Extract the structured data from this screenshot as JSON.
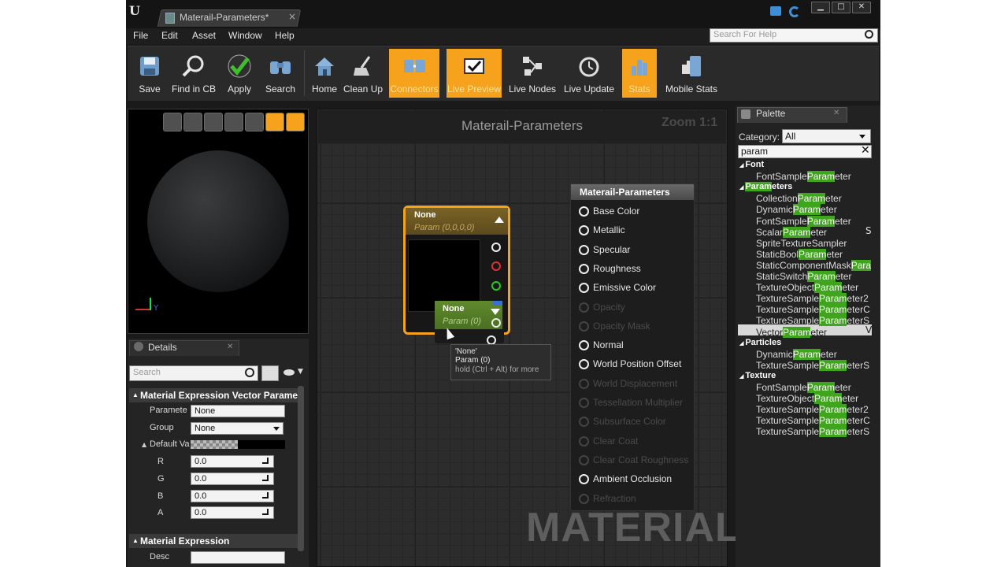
{
  "window": {
    "tab_title": "Materail-Parameters*",
    "tab_close": "×"
  },
  "menu": [
    "File",
    "Edit",
    "Asset",
    "Window",
    "Help"
  ],
  "help_search": {
    "placeholder": "Search For Help"
  },
  "toolbar": [
    {
      "label": "Save",
      "icon": "save-icon",
      "active": false
    },
    {
      "label": "Find in CB",
      "icon": "find-in-cb-icon",
      "active": false
    },
    {
      "label": "Apply",
      "icon": "apply-checkmark-icon",
      "active": false
    },
    {
      "label": "Search",
      "icon": "search-binoculars-icon",
      "active": false
    },
    {
      "label": "Home",
      "icon": "home-icon",
      "active": false
    },
    {
      "label": "Clean Up",
      "icon": "clean-up-broom-icon",
      "active": false
    },
    {
      "label": "Connectors",
      "icon": "connectors-icon",
      "active": true
    },
    {
      "label": "Live Preview",
      "icon": "live-preview-icon",
      "active": true
    },
    {
      "label": "Live Nodes",
      "icon": "live-nodes-icon",
      "active": false
    },
    {
      "label": "Live Update",
      "icon": "live-update-icon",
      "active": false
    },
    {
      "label": "Stats",
      "icon": "stats-icon",
      "active": true
    },
    {
      "label": "Mobile Stats",
      "icon": "mobile-stats-icon",
      "active": false
    }
  ],
  "details": {
    "title": "Details",
    "search_placeholder": "Search",
    "section1": "Material Expression Vector Paramet",
    "parameter_label": "Paramete",
    "parameter_value": "None",
    "group_label": "Group",
    "group_value": "None",
    "default_label": "Default Va",
    "r_label": "R",
    "r_value": "0.0",
    "g_label": "G",
    "g_value": "0.0",
    "b_label": "B",
    "b_value": "0.0",
    "a_label": "A",
    "a_value": "0.0",
    "section2": "Material Expression",
    "desc_label": "Desc",
    "desc_value": ""
  },
  "graph": {
    "title": "Materail-Parameters",
    "zoom": "Zoom 1:1",
    "watermark": "MATERIAL",
    "vector_node": {
      "title": "None",
      "subtitle": "Param (0,0,0,0)"
    },
    "scalar_node": {
      "title": "None",
      "subtitle": "Param (0)"
    },
    "tooltip": {
      "line1": "'None'",
      "line2": "Param (0)",
      "line3": "hold (Ctrl + Alt) for more"
    },
    "result_node": {
      "title": "Materail-Parameters",
      "inputs": [
        {
          "label": "Base Color",
          "enabled": true
        },
        {
          "label": "Metallic",
          "enabled": true
        },
        {
          "label": "Specular",
          "enabled": true
        },
        {
          "label": "Roughness",
          "enabled": true
        },
        {
          "label": "Emissive Color",
          "enabled": true
        },
        {
          "label": "Opacity",
          "enabled": false
        },
        {
          "label": "Opacity Mask",
          "enabled": false
        },
        {
          "label": "Normal",
          "enabled": true
        },
        {
          "label": "World Position Offset",
          "enabled": true
        },
        {
          "label": "World Displacement",
          "enabled": false
        },
        {
          "label": "Tessellation Multiplier",
          "enabled": false
        },
        {
          "label": "Subsurface Color",
          "enabled": false
        },
        {
          "label": "Clear Coat",
          "enabled": false
        },
        {
          "label": "Clear Coat Roughness",
          "enabled": false
        },
        {
          "label": "Ambient Occlusion",
          "enabled": true
        },
        {
          "label": "Refraction",
          "enabled": false
        }
      ]
    }
  },
  "palette": {
    "title": "Palette",
    "category_label": "Category:",
    "category_value": "All",
    "search_value": "param",
    "groups": [
      {
        "name_pre": "",
        "name_hl": "",
        "name_post": "Font",
        "items": [
          {
            "pre": "FontSample",
            "hl": "Param",
            "post": "eter"
          }
        ]
      },
      {
        "name_pre": "",
        "name_hl": "Param",
        "name_post": "eters",
        "items": [
          {
            "pre": "Collection",
            "hl": "Param",
            "post": "eter"
          },
          {
            "pre": "Dynamic",
            "hl": "Param",
            "post": "eter"
          },
          {
            "pre": "FontSample",
            "hl": "Param",
            "post": "eter"
          },
          {
            "pre": "Scalar",
            "hl": "Param",
            "post": "eter"
          },
          {
            "pre": "SpriteTextureSampler",
            "hl": "",
            "post": ""
          },
          {
            "pre": "StaticBool",
            "hl": "Param",
            "post": "eter"
          },
          {
            "pre": "StaticComponentMask",
            "hl": "Para",
            "post": ""
          },
          {
            "pre": "StaticSwitch",
            "hl": "Param",
            "post": "eter"
          },
          {
            "pre": "TextureObject",
            "hl": "Param",
            "post": "eter"
          },
          {
            "pre": "TextureSample",
            "hl": "Param",
            "post": "eter2"
          },
          {
            "pre": "TextureSample",
            "hl": "Param",
            "post": "eterC"
          },
          {
            "pre": "TextureSample",
            "hl": "Param",
            "post": "eterS"
          },
          {
            "pre": "Vector",
            "hl": "Param",
            "post": "eter"
          }
        ]
      },
      {
        "name_pre": "",
        "name_hl": "",
        "name_post": "Particles",
        "items": [
          {
            "pre": "Dynamic",
            "hl": "Param",
            "post": "eter"
          },
          {
            "pre": "TextureSample",
            "hl": "Param",
            "post": "eterS"
          }
        ]
      },
      {
        "name_pre": "",
        "name_hl": "",
        "name_post": "Texture",
        "items": [
          {
            "pre": "FontSample",
            "hl": "Param",
            "post": "eter"
          },
          {
            "pre": "TextureObject",
            "hl": "Param",
            "post": "eter"
          },
          {
            "pre": "TextureSample",
            "hl": "Param",
            "post": "eter2"
          },
          {
            "pre": "TextureSample",
            "hl": "Param",
            "post": "eterC"
          },
          {
            "pre": "TextureSample",
            "hl": "Param",
            "post": "eterS"
          }
        ]
      }
    ],
    "scalar_suffix": "S",
    "vector_suffix": "V"
  },
  "colors": {
    "accent": "#f6a21c",
    "highlight": "#3fa51c",
    "vector_node_header": "#7a6326",
    "scalar_node_header": "#5f8a2c"
  }
}
